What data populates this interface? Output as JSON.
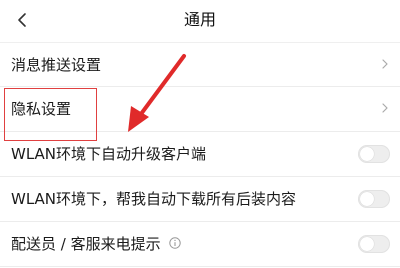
{
  "header": {
    "title": "通用",
    "back_icon": "chevron-left-icon"
  },
  "settings": [
    {
      "label": "消息推送设置",
      "control": "chevron"
    },
    {
      "label": "隐私设置",
      "control": "chevron"
    },
    {
      "label": "WLAN环境下自动升级客户端",
      "control": "toggle",
      "on": false
    },
    {
      "label": "WLAN环境下，帮我自动下载所有后装内容",
      "control": "toggle",
      "on": false
    },
    {
      "label": "配送员 / 客服来电提示",
      "control": "toggle",
      "on": false,
      "info_icon": "info-icon"
    }
  ],
  "annotation": {
    "highlight_color": "#e04040",
    "arrow_color": "#e02a2a"
  }
}
